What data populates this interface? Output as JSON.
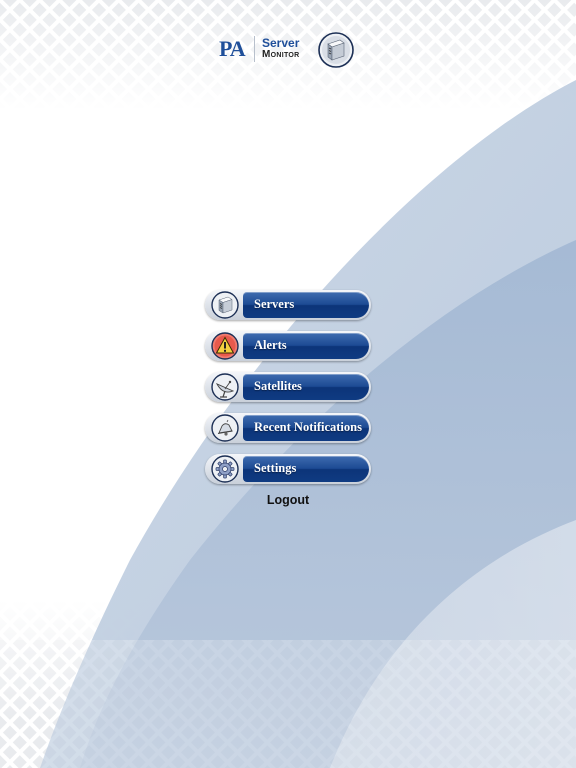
{
  "logo": {
    "brand": "PA",
    "product_line1": "Server",
    "product_line2": "Monitor"
  },
  "menu": {
    "items": [
      {
        "label": "Servers",
        "icon": "server-icon"
      },
      {
        "label": "Alerts",
        "icon": "alert-icon"
      },
      {
        "label": "Satellites",
        "icon": "satellite-dish-icon"
      },
      {
        "label": "Recent Notifications",
        "icon": "notification-icon"
      },
      {
        "label": "Settings",
        "icon": "gear-icon"
      }
    ]
  },
  "logout_label": "Logout",
  "colors": {
    "brand_blue": "#1f4f9a",
    "button_blue": "#1c4a93",
    "background_wave": "#a9bdd6"
  }
}
